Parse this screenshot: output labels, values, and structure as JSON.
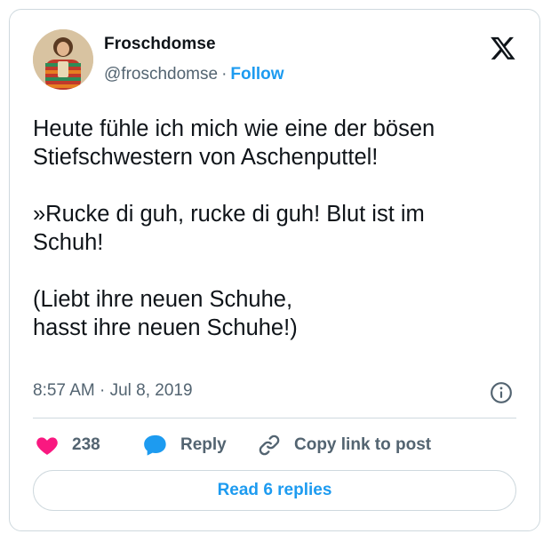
{
  "author": {
    "display_name": "Froschdomse",
    "handle": "@froschdomse",
    "separator": "·",
    "follow_label": "Follow"
  },
  "tweet": {
    "text": "Heute fühle ich mich wie eine der bösen\nStiefschwestern von Aschenputtel!\n\n»Rucke di guh, rucke di guh! Blut ist im\nSchuh!\n\n(Liebt ihre neuen Schuhe,\nhasst ihre neuen Schuhe!)",
    "time": "8:57 AM",
    "separator": "·",
    "date": "Jul 8, 2019"
  },
  "actions": {
    "like_count": "238",
    "reply_label": "Reply",
    "copy_label": "Copy link to post"
  },
  "footer": {
    "read_replies_label": "Read 6 replies"
  },
  "icons": {
    "logo": "x-logo-icon",
    "info": "info-icon",
    "like": "heart-icon",
    "reply": "speech-bubble-icon",
    "copy": "link-icon"
  },
  "colors": {
    "accent": "#1d9bf0",
    "like": "#f91880",
    "text": "#0f1419",
    "secondary": "#536471",
    "border": "#cfd9de"
  }
}
